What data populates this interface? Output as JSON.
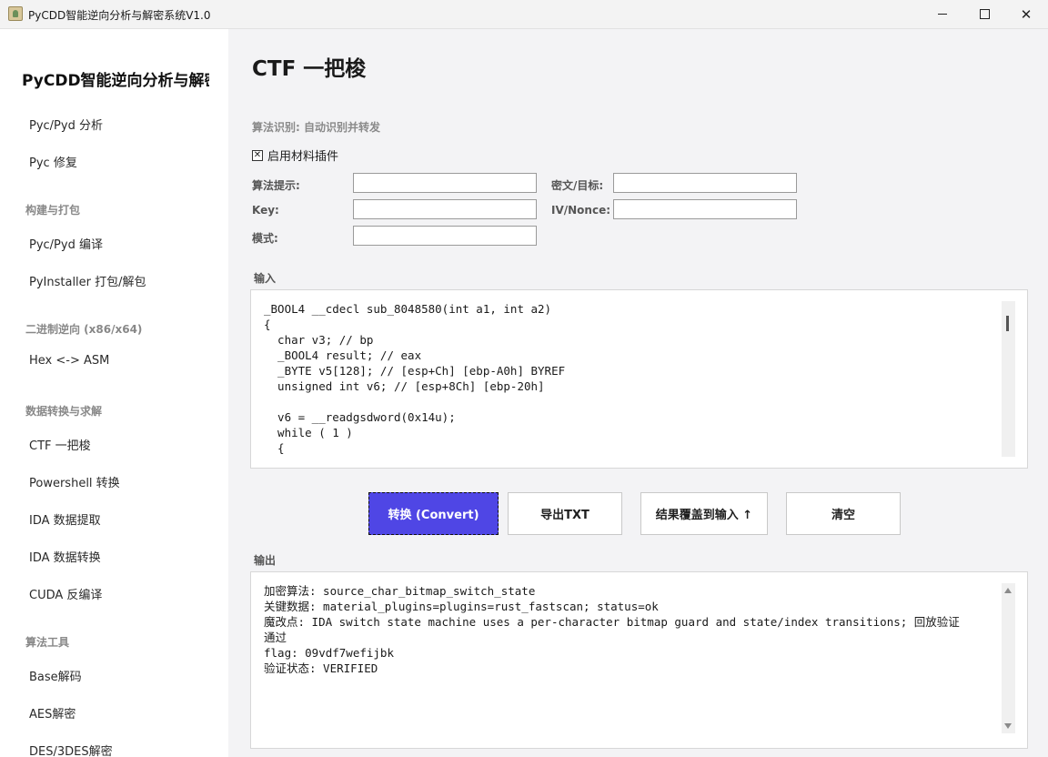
{
  "window": {
    "title": "PyCDD智能逆向分析与解密系统V1.0",
    "minimize_glyph": "—",
    "maximize_glyph": "☐",
    "close_glyph": "✕"
  },
  "sidebar": {
    "title": "PyCDD智能逆向分析与解密",
    "items": [
      {
        "label": "Pyc/Pyd 分析"
      },
      {
        "label": "Pyc 修复"
      },
      {
        "group": "构建与打包"
      },
      {
        "label": "Pyc/Pyd 编译"
      },
      {
        "label": "PyInstaller 打包/解包"
      },
      {
        "group": "二进制逆向 (x86/x64)"
      },
      {
        "label": "Hex <-> ASM"
      },
      {
        "group": "数据转换与求解"
      },
      {
        "label": "CTF 一把梭"
      },
      {
        "label": "Powershell 转换"
      },
      {
        "label": "IDA 数据提取"
      },
      {
        "label": "IDA 数据转换"
      },
      {
        "label": "CUDA 反编译"
      },
      {
        "group": "算法工具"
      },
      {
        "label": "Base解码"
      },
      {
        "label": "AES解密"
      },
      {
        "label": "DES/3DES解密"
      }
    ]
  },
  "main": {
    "page_title": "CTF 一把梭",
    "algo_status": "算法识别: 自动识别并转发",
    "plugin_checkbox": {
      "label": "启用材料插件",
      "checked": true,
      "mark": "✕"
    },
    "fields": {
      "algo_hint": {
        "label": "算法提示:",
        "value": ""
      },
      "cipher_target": {
        "label": "密文/目标:",
        "value": ""
      },
      "key": {
        "label": "Key:",
        "value": ""
      },
      "iv_nonce": {
        "label": "IV/Nonce:",
        "value": ""
      },
      "mode": {
        "label": "模式:",
        "value": ""
      }
    },
    "input_label": "输入",
    "input_text": "_BOOL4 __cdecl sub_8048580(int a1, int a2)\n{\n  char v3; // bp\n  _BOOL4 result; // eax\n  _BYTE v5[128]; // [esp+Ch] [ebp-A0h] BYREF\n  unsigned int v6; // [esp+8Ch] [ebp-20h]\n\n  v6 = __readgsdword(0x14u);\n  while ( 1 )\n  {",
    "buttons": {
      "convert": "转换 (Convert)",
      "export_txt": "导出TXT",
      "overwrite_input": "结果覆盖到输入 ↑",
      "clear": "清空"
    },
    "output_label": "输出",
    "output_text": "加密算法: source_char_bitmap_switch_state\n关键数据: material_plugins=plugins=rust_fastscan; status=ok\n魔改点: IDA switch state machine uses a per-character bitmap guard and state/index transitions; 回放验证\n通过\nflag: 09vdf7wefijbk\n验证状态: VERIFIED"
  }
}
